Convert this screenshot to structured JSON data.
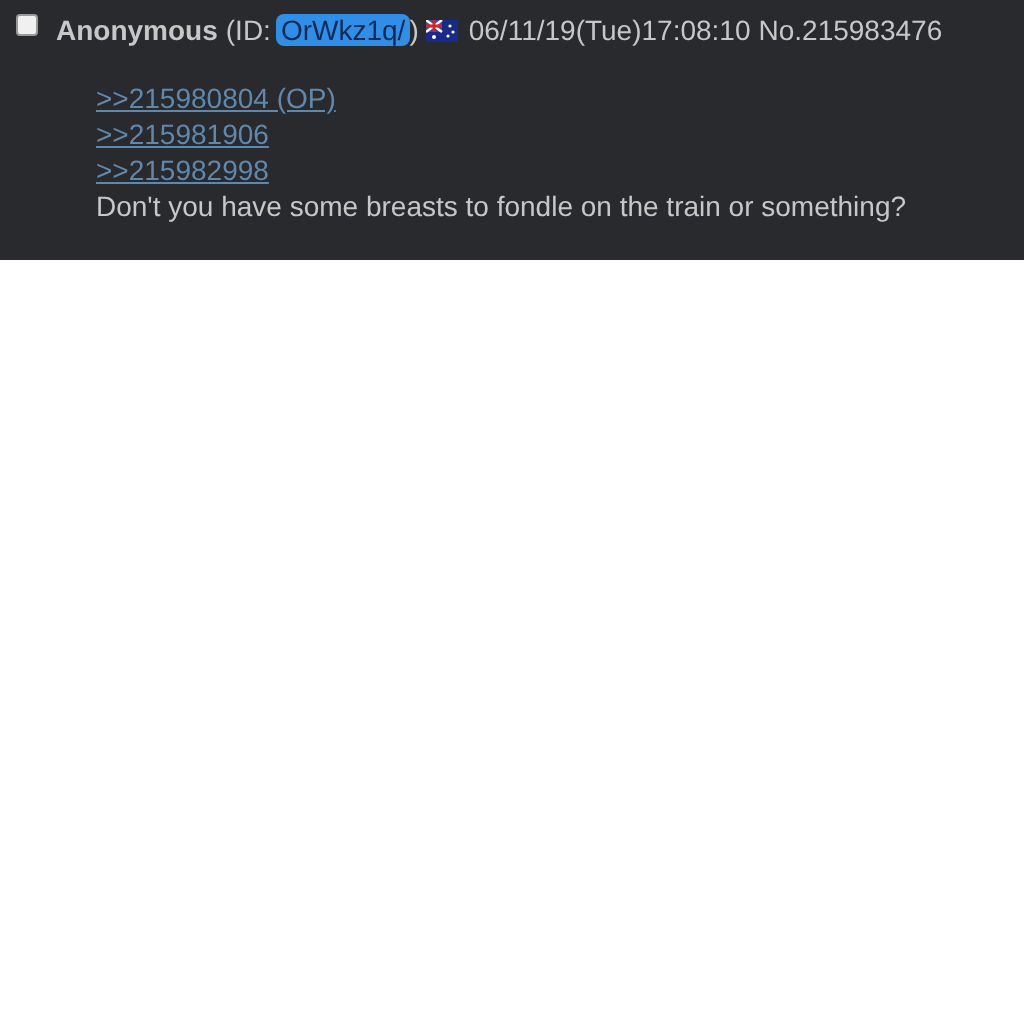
{
  "post": {
    "checked": false,
    "name": "Anonymous",
    "id_prefix": "(ID:",
    "id": "OrWkz1q/",
    "id_suffix": ")",
    "datetime": "06/11/19(Tue)17:08:10",
    "number": "No.215983476",
    "quotes": [
      ">>215980804 (OP)",
      ">>215981906",
      ">>215982998"
    ],
    "message": "Don't you have some breasts to fondle on the train or something?"
  }
}
